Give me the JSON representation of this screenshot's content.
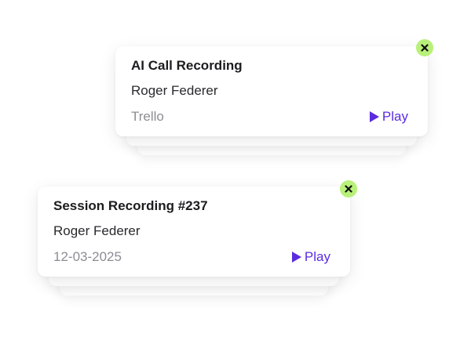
{
  "cards": [
    {
      "title": "AI Call Recording",
      "name": "Roger Federer",
      "meta": "Trello",
      "play_label": "Play",
      "close_icon": "close-icon",
      "play_icon": "play-icon"
    },
    {
      "title": "Session Recording #237",
      "name": "Roger Federer",
      "meta": "12-03-2025",
      "play_label": "Play",
      "close_icon": "close-icon",
      "play_icon": "play-icon"
    }
  ],
  "colors": {
    "accent": "#5b2be0",
    "close_badge": "#b9f07a",
    "meta_text": "#8c8c94",
    "title_text": "#1c1c1f"
  }
}
